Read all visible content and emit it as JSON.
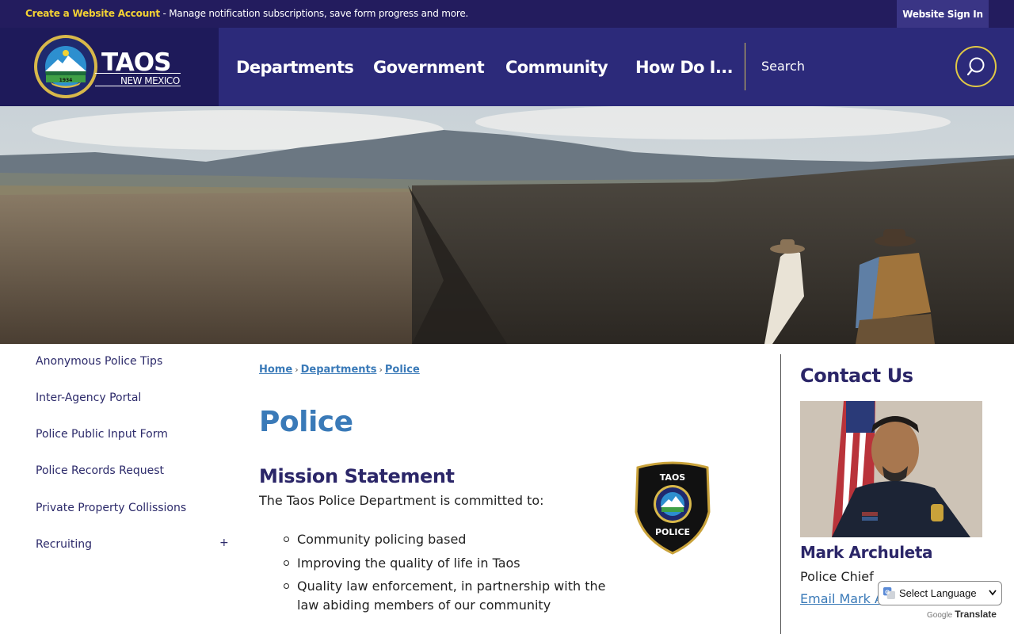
{
  "topbar": {
    "cta": "Create a Website Account",
    "message": " - Manage notification subscriptions, save form progress and more.",
    "signin_label": "Website Sign In"
  },
  "header": {
    "logo_title": "TAOS",
    "logo_subtitle": "NEW MEXICO",
    "seal_top_text": "TOWN of TAOS",
    "seal_bottom_text": "NEW MEXICO",
    "seal_year": "1934",
    "nav": [
      "Departments",
      "Government",
      "Community",
      "How Do I..."
    ],
    "search_label": "Search"
  },
  "sidebar": {
    "items": [
      "Anonymous Police Tips",
      "Inter-Agency Portal",
      "Police Public Input Form",
      "Police Records Request",
      "Private Property Collissions",
      "Recruiting"
    ],
    "expand_symbol": "+"
  },
  "breadcrumb": [
    "Home",
    "Departments",
    "Police"
  ],
  "breadcrumb_sep": "›",
  "main": {
    "title": "Police",
    "mission_heading": "Mission Statement",
    "mission_intro": "The Taos Police Department is committed to:",
    "bullets": [
      "Community policing based",
      "Improving the quality of life in Taos",
      "Quality law enforcement, in partnership with the law abiding members of our community"
    ],
    "badge_top": "TAOS",
    "badge_bottom": "POLICE"
  },
  "contact": {
    "heading": "Contact Us",
    "name": "Mark Archuleta",
    "role": "Police Chief",
    "email_label": "Email Mark A"
  },
  "translate": {
    "select_label": "Select Language",
    "powered_by": "Google",
    "translate_label": "Translate"
  },
  "colors": {
    "topbar": "#231c5e",
    "header": "#2c2a7a",
    "accent_gold": "#f3d233",
    "link_blue": "#3a7ab8",
    "heading_navy": "#2b2668"
  }
}
